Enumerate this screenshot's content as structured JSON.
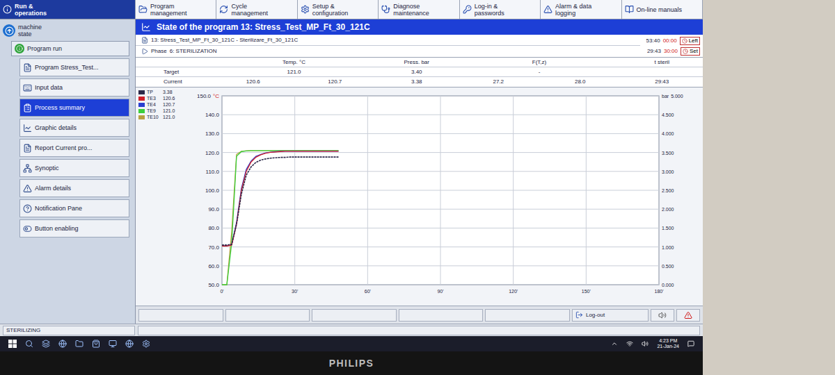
{
  "top_menu": [
    {
      "label": "Run & operations",
      "selected": true
    },
    {
      "label": "Program management",
      "selected": false
    },
    {
      "label": "Cycle management",
      "selected": false
    },
    {
      "label": "Setup & configuration",
      "selected": false
    },
    {
      "label": "Diagnose maintenance",
      "selected": false
    },
    {
      "label": "Log-in & passwords",
      "selected": false
    },
    {
      "label": "Alarm & data logging",
      "selected": false
    },
    {
      "label": "On-line manuals",
      "selected": false
    }
  ],
  "sidebar": {
    "items": [
      {
        "label": "machine state",
        "kind": "root",
        "selected": false
      },
      {
        "label": "Program run",
        "kind": "group",
        "selected": false
      },
      {
        "label": "Program Stress_Test...",
        "kind": "item",
        "selected": false
      },
      {
        "label": "Input data",
        "kind": "item",
        "selected": false
      },
      {
        "label": "Process summary",
        "kind": "item",
        "selected": true
      },
      {
        "label": "Graphic details",
        "kind": "item",
        "selected": false
      },
      {
        "label": "Report Current pro...",
        "kind": "item",
        "selected": false
      },
      {
        "label": "Synoptic",
        "kind": "item",
        "selected": false
      },
      {
        "label": "Alarm details",
        "kind": "item",
        "selected": false
      },
      {
        "label": "Notification Pane",
        "kind": "item",
        "selected": false
      },
      {
        "label": "Button enabling",
        "kind": "item",
        "selected": false
      }
    ],
    "status": "STERILIZING"
  },
  "window": {
    "title": "State of the program 13: Stress_Test_MP_Ft_30_121C"
  },
  "program": "13: Stress_Test_MP_Ft_30_121C - Sterilizare_Ft_30_121C",
  "phase": {
    "label": "Phase",
    "value": "6: STERILIZATION"
  },
  "timers": [
    {
      "elapsed": "53:40",
      "preset": "00:00",
      "button": "Left"
    },
    {
      "elapsed": "29:43",
      "preset": "30:00",
      "button": "Set"
    }
  ],
  "table": {
    "columns": [
      "Temp. °C",
      "Press. bar",
      "F(T,z)",
      "t steril"
    ],
    "rows": [
      {
        "label": "Target",
        "cells": [
          "121.0",
          "3.40",
          "-"
        ]
      },
      {
        "label": "Current",
        "cells": [
          "120.6",
          "120.7",
          "3.38",
          "27.2",
          "28.0",
          "29:43"
        ]
      }
    ]
  },
  "chart": {
    "unit_left": "°C",
    "unit_right": "bar",
    "y_ticks_left": [
      "150.0",
      "140.0",
      "130.0",
      "120.0",
      "110.0",
      "100.0",
      "90.0",
      "80.0",
      "70.0",
      "60.0",
      "50.0"
    ],
    "y_ticks_right": [
      "5.000",
      "4.500",
      "4.000",
      "3.500",
      "3.000",
      "2.500",
      "2.000",
      "1.500",
      "1.000",
      "0.500",
      "0.000"
    ],
    "x_ticks": [
      "0'",
      "30'",
      "60'",
      "90'",
      "120'",
      "150'",
      "180'"
    ],
    "series": [
      {
        "name": "TP",
        "reading": "3.38",
        "color": "#2d2a4a",
        "kind": "pressure",
        "values": [
          1.05,
          1.05,
          1.07,
          1.6,
          2.4,
          2.9,
          3.12,
          3.24,
          3.3,
          3.33,
          3.35,
          3.36,
          3.37,
          3.37,
          3.38,
          3.38,
          3.38,
          3.38,
          3.38,
          3.38,
          3.38,
          3.38,
          3.38,
          3.38,
          3.38
        ]
      },
      {
        "name": "TE3",
        "reading": "120.6",
        "color": "#d0202a",
        "kind": "temperature",
        "values": [
          70.5,
          70.5,
          71,
          82,
          100,
          110,
          115,
          117.5,
          118.8,
          119.6,
          120.1,
          120.3,
          120.5,
          120.6,
          120.6,
          120.6,
          120.6,
          120.6,
          120.6,
          120.6,
          120.6,
          120.6,
          120.6,
          120.6,
          120.6
        ]
      },
      {
        "name": "TE4",
        "reading": "120.7",
        "color": "#2a3fd0",
        "kind": "temperature",
        "values": [
          70.6,
          70.6,
          71.2,
          83,
          101,
          111,
          115.5,
          118,
          119,
          119.8,
          120.2,
          120.4,
          120.6,
          120.7,
          120.7,
          120.7,
          120.7,
          120.7,
          120.7,
          120.7,
          120.7,
          120.7,
          120.7,
          120.7,
          120.7
        ]
      },
      {
        "name": "TE9",
        "reading": "121.0",
        "color": "#3ccf3c",
        "kind": "temperature",
        "values": [
          50,
          50,
          72,
          118,
          120.5,
          120.8,
          121,
          121,
          121,
          121,
          121,
          121,
          121,
          121,
          121,
          121,
          121,
          121,
          121,
          121,
          121,
          121,
          121,
          121,
          121
        ]
      },
      {
        "name": "TE10",
        "reading": "121.0",
        "color": "#b8a040",
        "kind": "temperature",
        "values": [
          50,
          50,
          78,
          119,
          120.6,
          120.9,
          121,
          121,
          121,
          121,
          121,
          121,
          121,
          121,
          121,
          121,
          121,
          121,
          121,
          121,
          121,
          121,
          121,
          121,
          121
        ]
      }
    ]
  },
  "toolbar": {
    "logout": "Log-out"
  },
  "taskbar": {
    "time": "4:23 PM",
    "date": "21-Jan-24"
  },
  "monitor": {
    "brand": "PHILIPS"
  }
}
